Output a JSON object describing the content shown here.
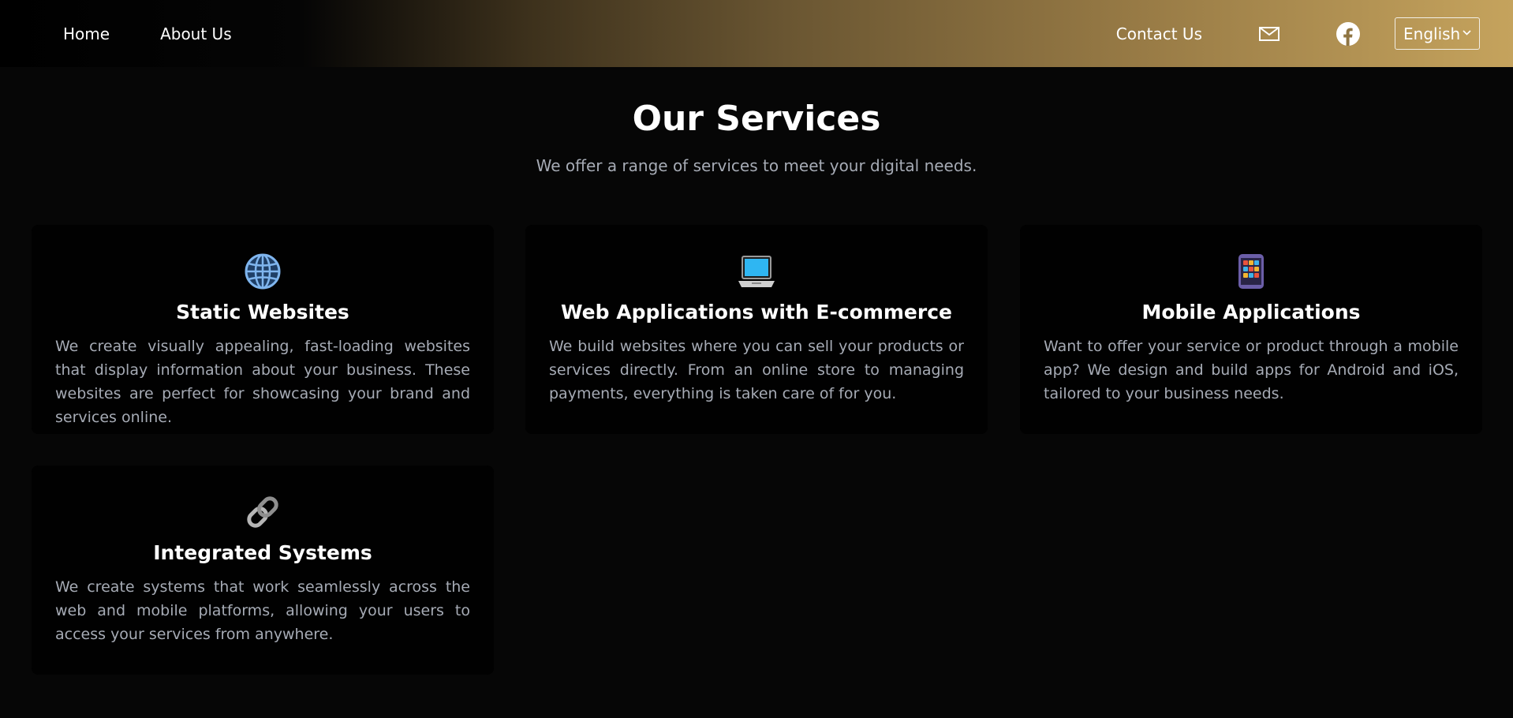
{
  "nav": {
    "home": "Home",
    "about": "About Us",
    "contact": "Contact Us",
    "mail_icon": "envelope-icon",
    "facebook_icon": "facebook-icon",
    "language": "English"
  },
  "colors": {
    "accent_gold": "#c5a35d",
    "background": "#060606",
    "card": "#010101",
    "muted_text": "#a6abb5"
  },
  "services": {
    "title": "Our Services",
    "subtitle": "We offer a range of services to meet your digital needs.",
    "cards": [
      {
        "icon": "globe-icon",
        "title": "Static Websites",
        "text": "We create visually appealing, fast-loading websites that display information about your business. These websites are perfect for showcasing your brand and services online."
      },
      {
        "icon": "laptop-icon",
        "title": "Web Applications with E-commerce",
        "text": "We build websites where you can sell your products or services directly. From an online store to managing payments, everything is taken care of for you."
      },
      {
        "icon": "mobile-phone-icon",
        "title": "Mobile Applications",
        "text": "Want to offer your service or product through a mobile app? We design and build apps for Android and iOS, tailored to your business needs."
      },
      {
        "icon": "chain-link-icon",
        "title": "Integrated Systems",
        "text": "We create systems that work seamlessly across the web and mobile platforms, allowing your users to access your services from anywhere."
      }
    ]
  }
}
